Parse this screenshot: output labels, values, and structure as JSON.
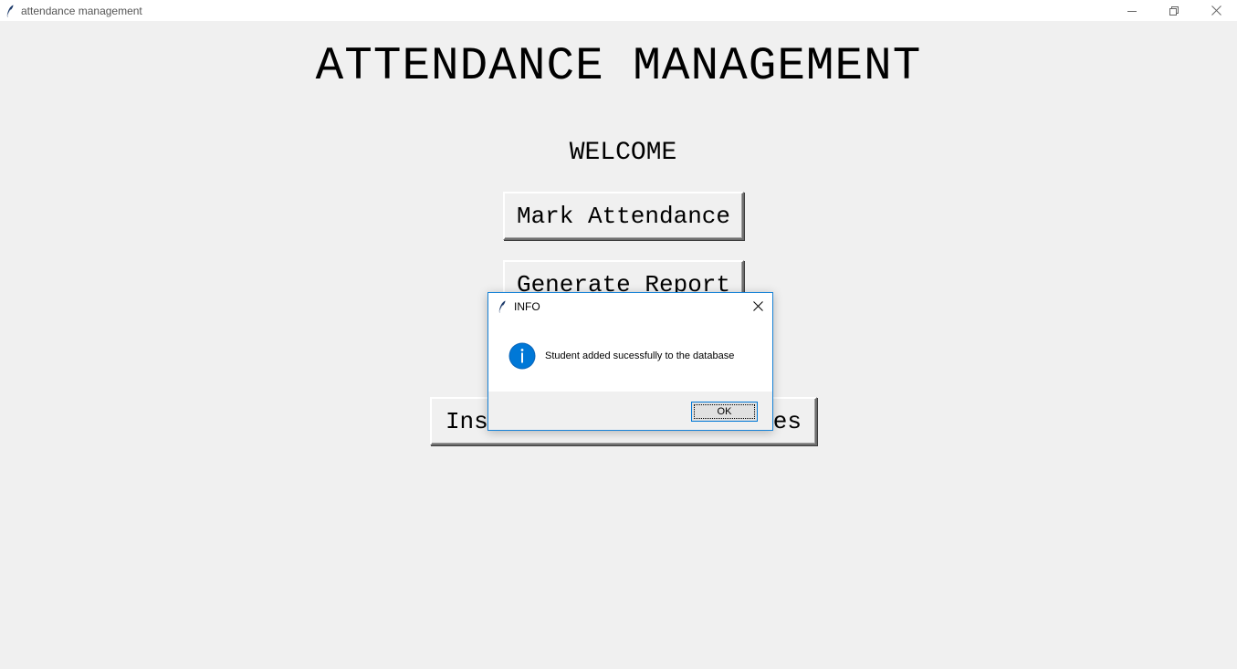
{
  "window": {
    "title": "attendance management",
    "icon": "feather-icon",
    "controls": [
      "minimize-icon",
      "restore-icon",
      "close-icon"
    ]
  },
  "main": {
    "heading": "ATTENDANCE MANAGEMENT",
    "welcome": "WELCOME",
    "buttons": {
      "mark_attendance": "Mark Attendance",
      "generate_report": "Generate Report",
      "insert": "Insert New Student Values"
    }
  },
  "dialog": {
    "title": "INFO",
    "icon": "info-icon",
    "message": "Student added sucessfully to the database",
    "ok_label": "OK"
  },
  "colors": {
    "background": "#f0f0f0",
    "dialog_border": "#1883d7",
    "info_icon": "#0078d7"
  }
}
